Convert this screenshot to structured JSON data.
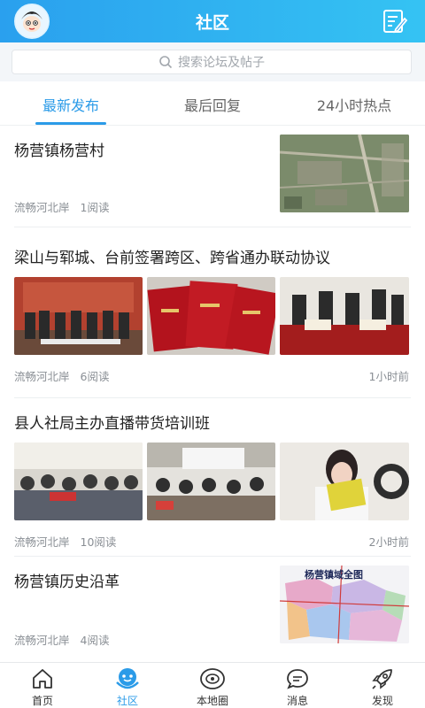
{
  "header": {
    "title": "社区"
  },
  "search": {
    "placeholder": "搜索论坛及帖子"
  },
  "tabs": [
    {
      "label": "最新发布",
      "active": true
    },
    {
      "label": "最后回复",
      "active": false
    },
    {
      "label": "24小时热点",
      "active": false
    }
  ],
  "posts": [
    {
      "title": "杨营镇杨营村",
      "author": "流畅河北岸",
      "reads": "1阅读",
      "time": ""
    },
    {
      "title": "梁山与郓城、台前签署跨区、跨省通办联动协议",
      "author": "流畅河北岸",
      "reads": "6阅读",
      "time": "1小时前"
    },
    {
      "title": "县人社局主办直播带货培训班",
      "author": "流畅河北岸",
      "reads": "10阅读",
      "time": "2小时前"
    },
    {
      "title": "杨营镇历史沿革",
      "author": "流畅河北岸",
      "reads": "4阅读",
      "time": "",
      "map_caption": "杨营镇域全图"
    }
  ],
  "nav": [
    {
      "label": "首页",
      "icon": "home-icon"
    },
    {
      "label": "社区",
      "icon": "community-icon",
      "active": true
    },
    {
      "label": "本地圈",
      "icon": "local-circle-icon"
    },
    {
      "label": "消息",
      "icon": "message-icon"
    },
    {
      "label": "发现",
      "icon": "rocket-icon"
    }
  ],
  "colors": {
    "accent": "#2b9be8",
    "header_start": "#2aa0ee",
    "header_end": "#35c3f3"
  }
}
